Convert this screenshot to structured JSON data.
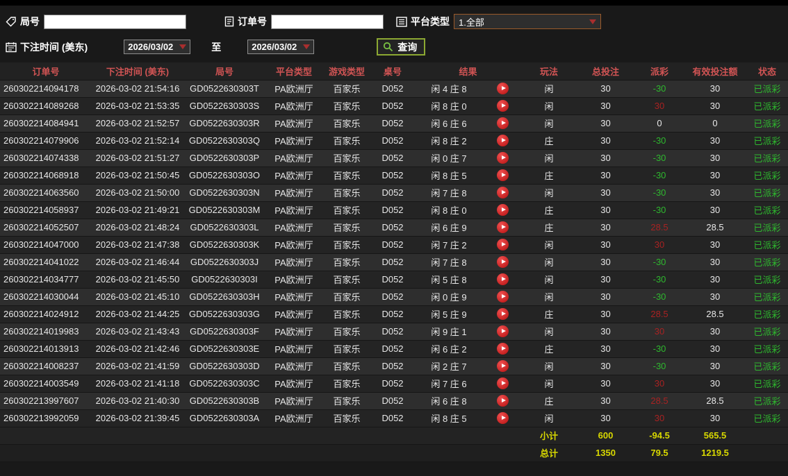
{
  "filters": {
    "round_label": "局号",
    "round_value": "",
    "order_label": "订单号",
    "order_value": "",
    "platform_label": "平台类型",
    "platform_value": "1.全部",
    "time_label": "下注时间 (美东)",
    "date_from": "2026/03/02",
    "to_label": "至",
    "date_to": "2026/03/02",
    "search_label": "查询"
  },
  "icons": {
    "round": "tag-icon",
    "order": "document-icon",
    "platform": "list-icon",
    "time": "calendar-icon",
    "search": "magnifier-icon",
    "play": "play-icon"
  },
  "colors": {
    "header_text": "#d15454",
    "win_payout": "#a82222",
    "loss_payout": "#2eb82e",
    "status_paid": "#2eb82e",
    "summary_text": "#d8d800",
    "search_border": "#8ca832",
    "play_button": "#c41212"
  },
  "table": {
    "columns": [
      "订单号",
      "下注时间 (美东)",
      "局号",
      "平台类型",
      "游戏类型",
      "桌号",
      "结果",
      "玩法",
      "总投注",
      "派彩",
      "有效投注额",
      "状态"
    ],
    "rows": [
      {
        "order_no": "260302214094178",
        "bet_time": "2026-03-02 21:54:16",
        "round_no": "GD0522630303T",
        "platform": "PA欧洲厅",
        "game": "百家乐",
        "table_no": "D052",
        "result": "闲 4 庄 8",
        "play": "闲",
        "total_bet": "30",
        "payout": "-30",
        "valid_bet": "30",
        "status": "已派彩"
      },
      {
        "order_no": "260302214089268",
        "bet_time": "2026-03-02 21:53:35",
        "round_no": "GD0522630303S",
        "platform": "PA欧洲厅",
        "game": "百家乐",
        "table_no": "D052",
        "result": "闲 8 庄 0",
        "play": "闲",
        "total_bet": "30",
        "payout": "30",
        "valid_bet": "30",
        "status": "已派彩"
      },
      {
        "order_no": "260302214084941",
        "bet_time": "2026-03-02 21:52:57",
        "round_no": "GD0522630303R",
        "platform": "PA欧洲厅",
        "game": "百家乐",
        "table_no": "D052",
        "result": "闲 6 庄 6",
        "play": "闲",
        "total_bet": "30",
        "payout": "0",
        "valid_bet": "0",
        "status": "已派彩"
      },
      {
        "order_no": "260302214079906",
        "bet_time": "2026-03-02 21:52:14",
        "round_no": "GD0522630303Q",
        "platform": "PA欧洲厅",
        "game": "百家乐",
        "table_no": "D052",
        "result": "闲 8 庄 2",
        "play": "庄",
        "total_bet": "30",
        "payout": "-30",
        "valid_bet": "30",
        "status": "已派彩"
      },
      {
        "order_no": "260302214074338",
        "bet_time": "2026-03-02 21:51:27",
        "round_no": "GD0522630303P",
        "platform": "PA欧洲厅",
        "game": "百家乐",
        "table_no": "D052",
        "result": "闲 0 庄 7",
        "play": "闲",
        "total_bet": "30",
        "payout": "-30",
        "valid_bet": "30",
        "status": "已派彩"
      },
      {
        "order_no": "260302214068918",
        "bet_time": "2026-03-02 21:50:45",
        "round_no": "GD0522630303O",
        "platform": "PA欧洲厅",
        "game": "百家乐",
        "table_no": "D052",
        "result": "闲 8 庄 5",
        "play": "庄",
        "total_bet": "30",
        "payout": "-30",
        "valid_bet": "30",
        "status": "已派彩"
      },
      {
        "order_no": "260302214063560",
        "bet_time": "2026-03-02 21:50:00",
        "round_no": "GD0522630303N",
        "platform": "PA欧洲厅",
        "game": "百家乐",
        "table_no": "D052",
        "result": "闲 7 庄 8",
        "play": "闲",
        "total_bet": "30",
        "payout": "-30",
        "valid_bet": "30",
        "status": "已派彩"
      },
      {
        "order_no": "260302214058937",
        "bet_time": "2026-03-02 21:49:21",
        "round_no": "GD0522630303M",
        "platform": "PA欧洲厅",
        "game": "百家乐",
        "table_no": "D052",
        "result": "闲 8 庄 0",
        "play": "庄",
        "total_bet": "30",
        "payout": "-30",
        "valid_bet": "30",
        "status": "已派彩"
      },
      {
        "order_no": "260302214052507",
        "bet_time": "2026-03-02 21:48:24",
        "round_no": "GD0522630303L",
        "platform": "PA欧洲厅",
        "game": "百家乐",
        "table_no": "D052",
        "result": "闲 6 庄 9",
        "play": "庄",
        "total_bet": "30",
        "payout": "28.5",
        "valid_bet": "28.5",
        "status": "已派彩"
      },
      {
        "order_no": "260302214047000",
        "bet_time": "2026-03-02 21:47:38",
        "round_no": "GD0522630303K",
        "platform": "PA欧洲厅",
        "game": "百家乐",
        "table_no": "D052",
        "result": "闲 7 庄 2",
        "play": "闲",
        "total_bet": "30",
        "payout": "30",
        "valid_bet": "30",
        "status": "已派彩"
      },
      {
        "order_no": "260302214041022",
        "bet_time": "2026-03-02 21:46:44",
        "round_no": "GD0522630303J",
        "platform": "PA欧洲厅",
        "game": "百家乐",
        "table_no": "D052",
        "result": "闲 7 庄 8",
        "play": "闲",
        "total_bet": "30",
        "payout": "-30",
        "valid_bet": "30",
        "status": "已派彩"
      },
      {
        "order_no": "260302214034777",
        "bet_time": "2026-03-02 21:45:50",
        "round_no": "GD0522630303I",
        "platform": "PA欧洲厅",
        "game": "百家乐",
        "table_no": "D052",
        "result": "闲 5 庄 8",
        "play": "闲",
        "total_bet": "30",
        "payout": "-30",
        "valid_bet": "30",
        "status": "已派彩"
      },
      {
        "order_no": "260302214030044",
        "bet_time": "2026-03-02 21:45:10",
        "round_no": "GD0522630303H",
        "platform": "PA欧洲厅",
        "game": "百家乐",
        "table_no": "D052",
        "result": "闲 0 庄 9",
        "play": "闲",
        "total_bet": "30",
        "payout": "-30",
        "valid_bet": "30",
        "status": "已派彩"
      },
      {
        "order_no": "260302214024912",
        "bet_time": "2026-03-02 21:44:25",
        "round_no": "GD0522630303G",
        "platform": "PA欧洲厅",
        "game": "百家乐",
        "table_no": "D052",
        "result": "闲 5 庄 9",
        "play": "庄",
        "total_bet": "30",
        "payout": "28.5",
        "valid_bet": "28.5",
        "status": "已派彩"
      },
      {
        "order_no": "260302214019983",
        "bet_time": "2026-03-02 21:43:43",
        "round_no": "GD0522630303F",
        "platform": "PA欧洲厅",
        "game": "百家乐",
        "table_no": "D052",
        "result": "闲 9 庄 1",
        "play": "闲",
        "total_bet": "30",
        "payout": "30",
        "valid_bet": "30",
        "status": "已派彩"
      },
      {
        "order_no": "260302214013913",
        "bet_time": "2026-03-02 21:42:46",
        "round_no": "GD0522630303E",
        "platform": "PA欧洲厅",
        "game": "百家乐",
        "table_no": "D052",
        "result": "闲 6 庄 2",
        "play": "庄",
        "total_bet": "30",
        "payout": "-30",
        "valid_bet": "30",
        "status": "已派彩"
      },
      {
        "order_no": "260302214008237",
        "bet_time": "2026-03-02 21:41:59",
        "round_no": "GD0522630303D",
        "platform": "PA欧洲厅",
        "game": "百家乐",
        "table_no": "D052",
        "result": "闲 2 庄 7",
        "play": "闲",
        "total_bet": "30",
        "payout": "-30",
        "valid_bet": "30",
        "status": "已派彩"
      },
      {
        "order_no": "260302214003549",
        "bet_time": "2026-03-02 21:41:18",
        "round_no": "GD0522630303C",
        "platform": "PA欧洲厅",
        "game": "百家乐",
        "table_no": "D052",
        "result": "闲 7 庄 6",
        "play": "闲",
        "total_bet": "30",
        "payout": "30",
        "valid_bet": "30",
        "status": "已派彩"
      },
      {
        "order_no": "260302213997607",
        "bet_time": "2026-03-02 21:40:30",
        "round_no": "GD0522630303B",
        "platform": "PA欧洲厅",
        "game": "百家乐",
        "table_no": "D052",
        "result": "闲 6 庄 8",
        "play": "庄",
        "total_bet": "30",
        "payout": "28.5",
        "valid_bet": "28.5",
        "status": "已派彩"
      },
      {
        "order_no": "260302213992059",
        "bet_time": "2026-03-02 21:39:45",
        "round_no": "GD0522630303A",
        "platform": "PA欧洲厅",
        "game": "百家乐",
        "table_no": "D052",
        "result": "闲 8 庄 5",
        "play": "闲",
        "total_bet": "30",
        "payout": "30",
        "valid_bet": "30",
        "status": "已派彩"
      }
    ],
    "subtotal": {
      "label": "小计",
      "total_bet": "600",
      "payout": "-94.5",
      "valid_bet": "565.5"
    },
    "total": {
      "label": "总计",
      "total_bet": "1350",
      "payout": "79.5",
      "valid_bet": "1219.5"
    }
  }
}
